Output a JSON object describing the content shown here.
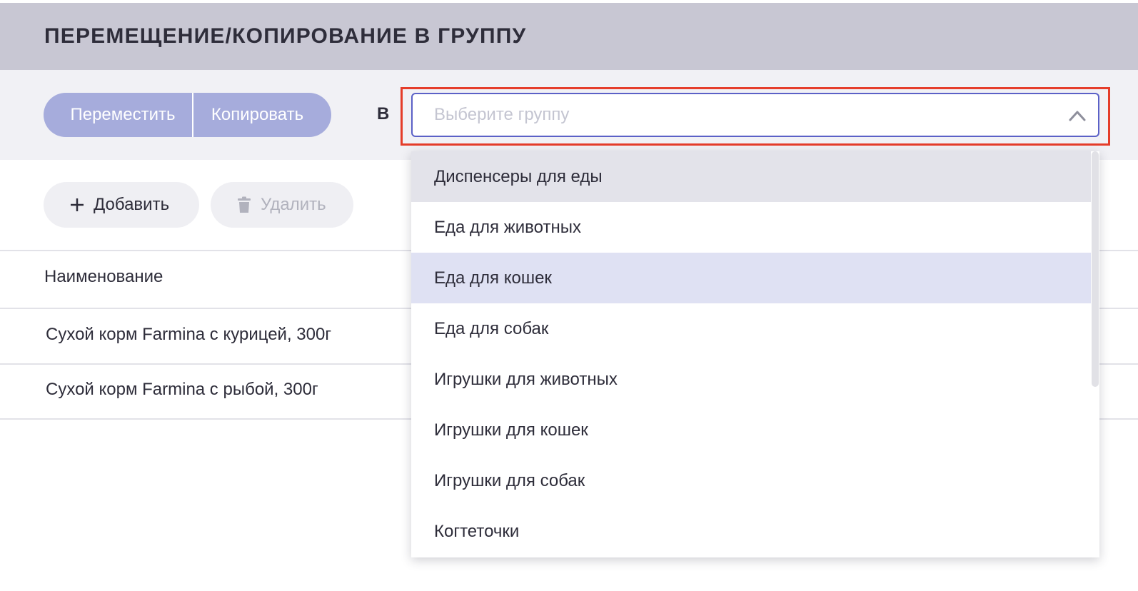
{
  "header": {
    "title": "ПЕРЕМЕЩЕНИЕ/КОПИРОВАНИЕ В ГРУППУ"
  },
  "mode_toggle": {
    "move_label": "Переместить",
    "copy_label": "Копировать"
  },
  "target": {
    "label": "В",
    "placeholder": "Выберите группу"
  },
  "actions": {
    "add_label": "Добавить",
    "delete_label": "Удалить"
  },
  "table": {
    "column_header": "Наименование",
    "rows": [
      {
        "name": "Сухой корм Farmina с курицей, 300г"
      },
      {
        "name": "Сухой корм Farmina с рыбой, 300г"
      }
    ]
  },
  "dropdown": {
    "items": [
      {
        "label": "Диспенсеры для еды",
        "state": "hover"
      },
      {
        "label": "Еда для животных",
        "state": ""
      },
      {
        "label": "Еда для кошек",
        "state": "selected"
      },
      {
        "label": "Еда для собак",
        "state": ""
      },
      {
        "label": "Игрушки для животных",
        "state": ""
      },
      {
        "label": "Игрушки для кошек",
        "state": ""
      },
      {
        "label": "Игрушки для собак",
        "state": ""
      },
      {
        "label": "Когтеточки",
        "state": ""
      }
    ]
  },
  "colors": {
    "header_bg": "#c8c7d3",
    "accent": "#5b61c7",
    "segment_bg": "#a6acdc",
    "focus_outline": "#e53d2a"
  },
  "icons": {
    "select_chevron": "chevron-up-icon",
    "add": "plus-icon",
    "delete": "trash-icon"
  }
}
